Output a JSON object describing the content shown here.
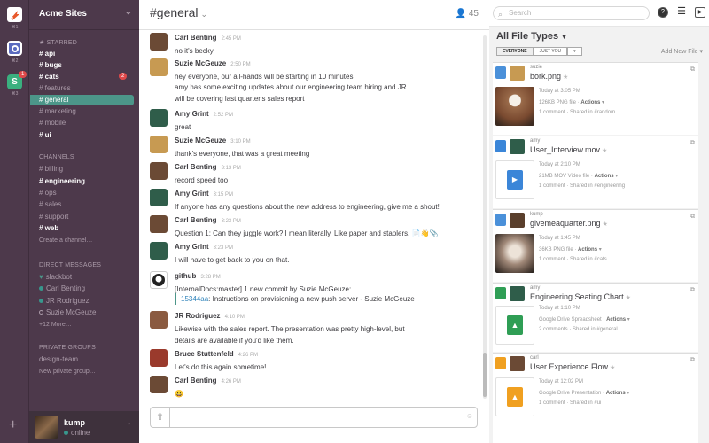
{
  "teams": [
    {
      "letter": "Z",
      "color": "#e8582b",
      "key": "⌘1"
    },
    {
      "letter": "○",
      "color": "#5b6bbf",
      "key": "⌘2"
    },
    {
      "letter": "S",
      "color": "#3ab07f",
      "key": "⌘3",
      "badge": "1"
    }
  ],
  "sidebar": {
    "team_name": "Acme Sites",
    "starred_label": "★ STARRED",
    "starred": [
      {
        "name": "# api",
        "bold": true
      },
      {
        "name": "# bugs",
        "bold": true
      },
      {
        "name": "# cats",
        "bold": true,
        "badge": "2"
      },
      {
        "name": "# features"
      },
      {
        "name": "# general",
        "active": true
      },
      {
        "name": "# marketing"
      },
      {
        "name": "# mobile"
      },
      {
        "name": "# ui",
        "bold": true
      }
    ],
    "channels_label": "CHANNELS",
    "channels": [
      {
        "name": "# billing"
      },
      {
        "name": "# engineering",
        "bold": true
      },
      {
        "name": "# ops"
      },
      {
        "name": "# sales"
      },
      {
        "name": "# support"
      },
      {
        "name": "# web",
        "bold": true
      }
    ],
    "create_channel": "Create a channel…",
    "dm_label": "DIRECT MESSAGES",
    "dms": [
      {
        "name": "slackbot",
        "status": "♥"
      },
      {
        "name": "Carl Benting"
      },
      {
        "name": "JR Rodriguez"
      },
      {
        "name": "Suzie McGeuze"
      }
    ],
    "more_dms": "+12 More…",
    "groups_label": "PRIVATE GROUPS",
    "groups": [
      "design-team"
    ],
    "new_group": "New private group…",
    "user": {
      "name": "kump",
      "status": "online"
    }
  },
  "header": {
    "channel": "#general",
    "member_count": "45"
  },
  "messages": [
    {
      "author": "Carl Benting",
      "time": "2:45 PM",
      "lines": [
        "no it's becky"
      ],
      "avatar": "#6b4a35"
    },
    {
      "author": "Suzie McGeuze",
      "time": "2:50 PM",
      "lines": [
        "hey everyone, our all-hands will be starting in 10 minutes",
        "amy has some exciting updates about our engineering team hiring and JR",
        "will be covering last quarter's sales report"
      ],
      "avatar": "#c79a52"
    },
    {
      "author": "Amy Grint",
      "time": "2:52 PM",
      "lines": [
        "great"
      ],
      "avatar": "#2f5d4a"
    },
    {
      "author": "Suzie McGeuze",
      "time": "3:10 PM",
      "lines": [
        "thank's everyone, that was a great meeting"
      ],
      "avatar": "#c79a52"
    },
    {
      "author": "Carl Benting",
      "time": "3:13 PM",
      "lines": [
        "record speed too"
      ],
      "avatar": "#6b4a35"
    },
    {
      "author": "Amy Grint",
      "time": "3:15 PM",
      "lines": [
        "If anyone has any questions about the new address to engineering, give me a shout!"
      ],
      "avatar": "#2f5d4a"
    },
    {
      "author": "Carl Benting",
      "time": "3:23 PM",
      "lines": [
        "Question 1: Can they juggle work? I mean literally. Like paper and staplers. 📄👋📎"
      ],
      "avatar": "#6b4a35"
    },
    {
      "author": "Amy Grint",
      "time": "3:23 PM",
      "lines": [
        "I will have to get back to you on that."
      ],
      "avatar": "#2f5d4a"
    },
    {
      "author": "github",
      "time": "3:28 PM",
      "lines": [
        "[InternalDocs:master] 1 new commit by Suzie McGeuze:"
      ],
      "commit": "15344aa",
      "commit_msg": ": Instructions on provisioning a new push server - Suzie McGeuze",
      "avatar": "#222"
    },
    {
      "author": "JR Rodriguez",
      "time": "4:10 PM",
      "lines": [
        "Likewise with the sales report. The presentation was pretty high-level, but",
        "details are available if you'd like them."
      ],
      "avatar": "#8a5a40"
    },
    {
      "author": "Bruce Stuttenfeld",
      "time": "4:26 PM",
      "lines": [
        "Let's do this again sometime!"
      ],
      "avatar": "#9a3a2c"
    },
    {
      "author": "Carl Benting",
      "time": "4:26 PM",
      "lines": [
        "😃"
      ],
      "avatar": "#6b4a35"
    }
  ],
  "topbar": {
    "search_placeholder": "Search"
  },
  "files": {
    "title": "All File Types",
    "filter_all": "EVERYONE",
    "filter_mine": "JUST YOU",
    "add_new": "Add New File",
    "items": [
      {
        "user": "suzie",
        "name": "bork.png",
        "type_color": "#4a90d9",
        "when": "Today at 3:05 PM",
        "desc": "126KB PNG file",
        "actions": "Actions",
        "comments": "1 comment",
        "shared": "Shared in #random",
        "thumb": "#9a6b4a",
        "user_color": "#c79a52"
      },
      {
        "user": "amy",
        "name": "User_Interview.mov",
        "type_color": "#3b86d8",
        "when": "Today at 2:10 PM",
        "desc": "21MB MOV Video file",
        "actions": "Actions",
        "comments": "1 comment",
        "shared": "Shared in #engineering",
        "thumb": "#ffffff",
        "user_color": "#2f5d4a"
      },
      {
        "user": "kump",
        "name": "givemeaquarter.png",
        "type_color": "#4a90d9",
        "when": "Today at 1:45 PM",
        "desc": "36KB PNG file",
        "actions": "Actions",
        "comments": "1 comment",
        "shared": "Shared in #cats",
        "thumb": "#7d6a60",
        "user_color": "#5a3f2c"
      },
      {
        "user": "amy",
        "name": "Engineering Seating Chart",
        "type_color": "#2f9e55",
        "when": "Today at 1:10 PM",
        "desc": "Google Drive Spreadsheet",
        "actions": "Actions",
        "comments": "2 comments",
        "shared": "Shared in #general",
        "thumb": "#ffffff",
        "user_color": "#2f5d4a"
      },
      {
        "user": "carl",
        "name": "User Experience Flow",
        "type_color": "#f0a020",
        "when": "Today at 12:02 PM",
        "desc": "Google Drive Presentation",
        "actions": "Actions",
        "comments": "1 comment",
        "shared": "Shared in #ui",
        "thumb": "#ffffff",
        "user_color": "#6b4a35"
      }
    ]
  }
}
